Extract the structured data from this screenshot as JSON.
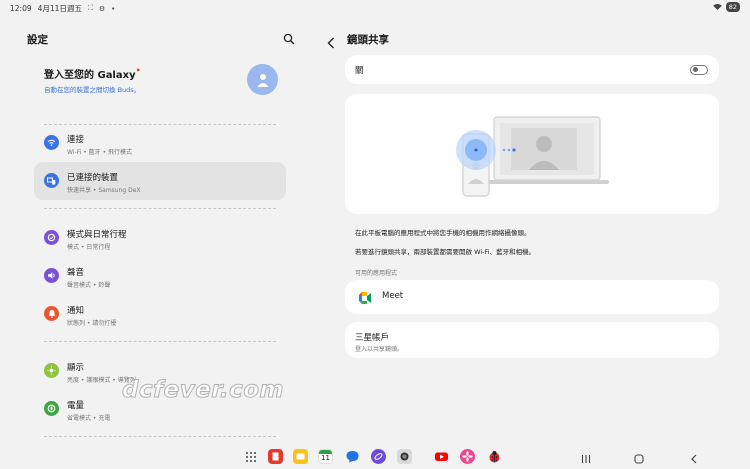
{
  "status": {
    "time": "12:09",
    "date": "4月11日週五",
    "battery": "82"
  },
  "left": {
    "title": "設定",
    "account": {
      "name": "登入至您的 Galaxy",
      "dot": "•",
      "sub": "自動在您的裝置之間切換 Buds。"
    },
    "items": [
      {
        "label": "連接",
        "sub": "Wi-Fi • 藍牙 • 飛行模式",
        "icon": "wifi-icon",
        "color": "#3b73e6"
      },
      {
        "label": "已連接的裝置",
        "sub": "快速共享 • Samsung DeX",
        "icon": "connected-devices-icon",
        "color": "#3b73e6"
      },
      {
        "label": "模式與日常行程",
        "sub": "模式 • 日常行程",
        "icon": "modes-icon",
        "color": "#7b52d6"
      },
      {
        "label": "聲音",
        "sub": "聲音模式 • 鈴聲",
        "icon": "sound-icon",
        "color": "#7b52d6"
      },
      {
        "label": "通知",
        "sub": "狀態列 • 請勿打擾",
        "icon": "notification-icon",
        "color": "#e8572f"
      },
      {
        "label": "顯示",
        "sub": "亮度 • 護眼模式 • 導覽列",
        "icon": "display-icon",
        "color": "#8cc63f"
      },
      {
        "label": "電量",
        "sub": "省電模式 • 充電",
        "icon": "battery-icon",
        "color": "#3fa53f"
      }
    ]
  },
  "right": {
    "title": "鏡頭共享",
    "toggle_label": "關",
    "toggle_on": false,
    "desc1": "在此平板電腦的應用程式中將您手機的相機用作網絡攝像頭。",
    "desc2": "若要進行鏡頭共享，兩部裝置都需要開啟 Wi-Fi、藍牙和相機。",
    "section_label": "可用的應用程式",
    "app_name": "Meet",
    "samsung_title": "三星帳戶",
    "samsung_sub": "登入以共享鏡頭。"
  },
  "watermark": "dcfever.com",
  "dock": {
    "calendar_day": "11",
    "apps": [
      "apps-grid-icon",
      "notes-icon",
      "folder-icon",
      "calendar-icon",
      "messages-icon",
      "internet-icon",
      "camera-icon",
      "youtube-icon",
      "gallery-icon",
      "ladybug-icon"
    ]
  }
}
